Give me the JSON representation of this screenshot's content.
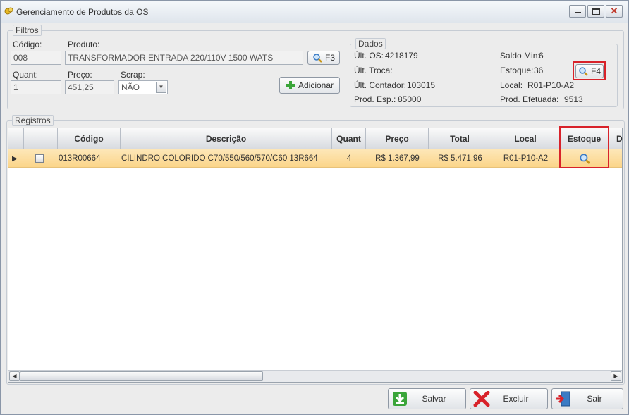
{
  "window": {
    "title": "Gerenciamento de Produtos da OS",
    "close_glyph": "✕"
  },
  "filtros": {
    "title": "Filtros",
    "codigo_label": "Código:",
    "codigo_value": "008",
    "produto_label": "Produto:",
    "produto_value": "TRANSFORMADOR ENTRADA 220/110V 1500 WATS",
    "f3_label": "F3",
    "quant_label": "Quant:",
    "quant_value": "1",
    "preco_label": "Preço:",
    "preco_value": "451,25",
    "scrap_label": "Scrap:",
    "scrap_value": "NÃO",
    "adicionar_label": "Adicionar"
  },
  "dados": {
    "title": "Dados",
    "ult_os_label": "Últ. OS:",
    "ult_os_value": "4218179",
    "ult_troca_label": "Últ. Troca:",
    "ult_contador_label": "Últ. Contador:",
    "ult_contador_value": "103015",
    "prod_esp_label": "Prod. Esp.:",
    "prod_esp_value": "85000",
    "saldo_min_label": "Saldo Min:",
    "saldo_min_value": "6",
    "estoque_label": "Estoque:",
    "estoque_value": "36",
    "local_label": "Local:",
    "local_value": "R01-P10-A2",
    "prod_efetuada_label": "Prod. Efetuada:",
    "prod_efetuada_value": "9513",
    "f4_label": "F4"
  },
  "registros": {
    "title": "Registros",
    "columns": [
      "Código",
      "Descrição",
      "Quant",
      "Preço",
      "Total",
      "Local",
      "Estoque",
      "D"
    ],
    "rows": [
      {
        "codigo": "013R00664",
        "descricao": "CILINDRO COLORIDO C70/550/560/570/C60 13R664",
        "quant": "4",
        "preco": "R$ 1.367,99",
        "total": "R$ 5.471,96",
        "local": "R01-P10-A2"
      }
    ]
  },
  "footer": {
    "salvar_label": "Salvar",
    "excluir_label": "Excluir",
    "sair_label": "Sair"
  },
  "colors": {
    "highlight": "#d8222a",
    "selected_row": "#fbd58a",
    "accent_green": "#3aa53a"
  }
}
